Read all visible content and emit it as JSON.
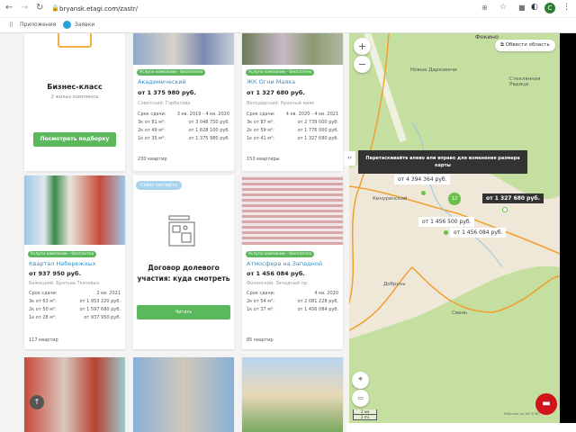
{
  "browser": {
    "url": "bryansk.etagi.com/zastr/",
    "bookmarks": [
      {
        "label": "Приложения"
      },
      {
        "label": "Заявки"
      }
    ],
    "profile_initial": "C"
  },
  "promo": {
    "title": "Бизнес-класс",
    "subtitle": "2 жилых комплекса",
    "button": "Посмотреть подборку"
  },
  "article": {
    "badge": "Совет эксперта",
    "title": "Договор долевого участия: куда смотреть",
    "button": "Читать"
  },
  "cards": [
    {
      "badge": "Услуги компании - бесплатно",
      "title": "Академический",
      "price": "от 1 375 980 руб.",
      "district": "Советский, Горбатова",
      "rows": [
        [
          "Срок сдачи:",
          "3 кв. 2019 - 4 кв. 2020"
        ],
        [
          "3к от 81 м²:",
          "от 3 048 750 руб."
        ],
        [
          "2к от 49 м²:",
          "от 1 828 100 руб."
        ],
        [
          "1к от 35 м²:",
          "от 1 375 980 руб."
        ]
      ],
      "count": "230 квартир"
    },
    {
      "badge": "Услуги компании - бесплатно",
      "title": "ЖК Огни Маяка",
      "price": "от 1 327 680 руб.",
      "district": "Володарский, Красный маяк",
      "rows": [
        [
          "Срок сдачи:",
          "4 кв. 2020 - 4 кв. 2021"
        ],
        [
          "3к от 87 м²:",
          "от 2 739 000 руб."
        ],
        [
          "2к от 59 м²:",
          "от 1 776 000 руб."
        ],
        [
          "1к от 41 м²:",
          "от 1 327 680 руб."
        ]
      ],
      "count": "153 квартиры"
    },
    {
      "badge": "Услуги компании - бесплатно",
      "title": "Квартал Набережных",
      "price": "от 937 950 руб.",
      "district": "Бежицкий, Братьев Ткачевых",
      "rows": [
        [
          "Срок сдачи:",
          "2 кв. 2021"
        ],
        [
          "3к от 63 м²:",
          "от 1 953 220 руб."
        ],
        [
          "2к от 50 м²:",
          "от 1 597 680 руб."
        ],
        [
          "1к от 28 м²:",
          "от 937 950 руб."
        ]
      ],
      "count": "117 квартир"
    },
    {
      "badge": "Услуги компании - бесплатно",
      "title": "Атмосфера на Западной",
      "price": "от 1 456 084 руб.",
      "district": "Фокинский, Западный пр.",
      "rows": [
        [
          "Срок сдачи:",
          "4 кв. 2020"
        ],
        [
          "2к от 54 м²:",
          "от 2 081 228 руб."
        ],
        [
          "1к от 37 м²:",
          "от 1 456 084 руб."
        ]
      ],
      "count": "85 квартир"
    }
  ],
  "map": {
    "draw_area": "Обвести область",
    "tooltip": "Перетаскивайте влево или вправо для изменения размера карты",
    "places": [
      "Фокино",
      "Новые Дарковичи",
      "Стеклянная Радица",
      "Кинуринский",
      "Добрунь",
      "Свень"
    ],
    "price_labels": [
      "от 4 394 364 руб.",
      "от 1 327 680 руб.",
      "от 1 456 500 руб.",
      "от 1 456 084 руб."
    ],
    "cluster_count": "12",
    "scale": [
      "2 км",
      "2 mi"
    ],
    "attribution": "Работает на API 2ГИС"
  },
  "colors": {
    "accent": "#5cb85c",
    "link": "#3a8fc6",
    "map_green": "#c4dfa0",
    "chat": "#d0121b"
  }
}
